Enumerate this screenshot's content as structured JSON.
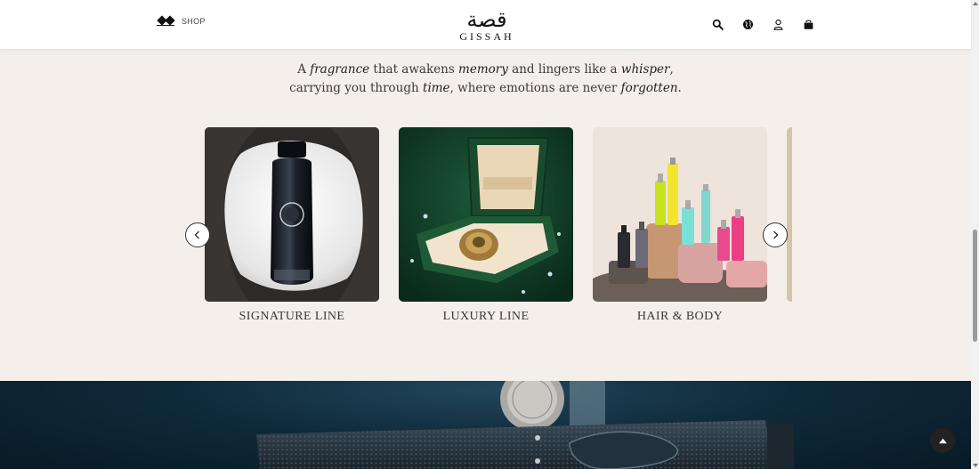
{
  "header": {
    "shop_label": "SHOP",
    "logo_arabic": "قصة",
    "logo_latin": "GISSAH",
    "icons": [
      "search-icon",
      "globe-icon",
      "user-icon",
      "bag-icon"
    ]
  },
  "tagline": {
    "line1": [
      {
        "t": "A ",
        "i": false
      },
      {
        "t": "fragrance",
        "i": true
      },
      {
        "t": " that awakens ",
        "i": false
      },
      {
        "t": "memory",
        "i": true
      },
      {
        "t": " and lingers like a ",
        "i": false
      },
      {
        "t": "whisper",
        "i": true
      },
      {
        "t": ",",
        "i": false
      }
    ],
    "line2": [
      {
        "t": "carrying you through ",
        "i": false
      },
      {
        "t": "time",
        "i": true
      },
      {
        "t": ", where emotions are never ",
        "i": false
      },
      {
        "t": "forgotten",
        "i": true
      },
      {
        "t": ".",
        "i": false
      }
    ]
  },
  "carousel": {
    "items": [
      {
        "label": "SIGNATURE LINE"
      },
      {
        "label": "LUXURY LINE"
      },
      {
        "label": "HAIR & BODY"
      }
    ],
    "prev_icon": "chevron-left-icon",
    "next_icon": "chevron-right-icon"
  },
  "colors": {
    "page_bg": "#f5efeb",
    "header_bg": "#ffffff",
    "hero_bg": "#0f2a3a",
    "text": "#3a3a3a"
  }
}
